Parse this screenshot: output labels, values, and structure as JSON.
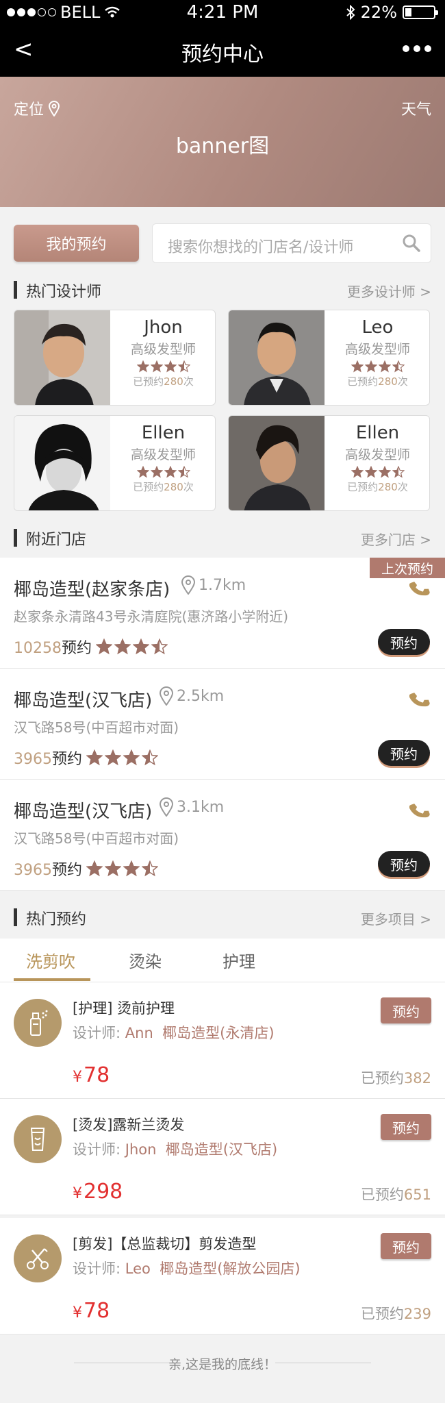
{
  "status_bar": {
    "carrier": "BELL",
    "time": "4:21 PM",
    "battery": "22%",
    "signal_dots_filled": 3,
    "signal_dots_total": 5
  },
  "navbar": {
    "back": "<",
    "title": "预约中心"
  },
  "banner": {
    "location_label": "定位",
    "weather_label": "天气",
    "text": "banner图"
  },
  "my_booking_button": "我的预约",
  "search": {
    "placeholder": "搜索你想找的门店名/设计师"
  },
  "designers_section": {
    "title": "热门设计师",
    "more": "更多设计师 >"
  },
  "designers": [
    {
      "name": "Jhon",
      "role": "高级发型师",
      "rating": 3.5,
      "count_prefix": "已预约",
      "count": "280",
      "count_suffix": "次"
    },
    {
      "name": "Leo",
      "role": "高级发型师",
      "rating": 3.5,
      "count_prefix": "已预约",
      "count": "280",
      "count_suffix": "次"
    },
    {
      "name": "Ellen",
      "role": "高级发型师",
      "rating": 3.5,
      "count_prefix": "已预约",
      "count": "280",
      "count_suffix": "次"
    },
    {
      "name": "Ellen",
      "role": "高级发型师",
      "rating": 3.5,
      "count_prefix": "已预约",
      "count": "280",
      "count_suffix": "次"
    }
  ],
  "stores_section": {
    "title": "附近门店",
    "more": "更多门店 >"
  },
  "stores": [
    {
      "name": "椰岛造型(赵家条店)",
      "distance": "1.7km",
      "address": "赵家条永清路43号永清庭院(惠济路小学附近)",
      "count": "10258",
      "count_label": "预约",
      "rating": 3.5,
      "book": "预约",
      "tag": "上次预约"
    },
    {
      "name": "椰岛造型(汉飞店)",
      "distance": "2.5km",
      "address": "汉飞路58号(中百超市对面)",
      "count": "3965",
      "count_label": "预约",
      "rating": 3.5,
      "book": "预约"
    },
    {
      "name": "椰岛造型(汉飞店)",
      "distance": "3.1km",
      "address": "汉飞路58号(中百超市对面)",
      "count": "3965",
      "count_label": "预约",
      "rating": 3.5,
      "book": "预约"
    }
  ],
  "hot_section": {
    "title": "热门预约",
    "more": "更多项目 >"
  },
  "tabs": [
    "洗剪吹",
    "烫染",
    "护理"
  ],
  "services": [
    {
      "icon": "spray-bottle-icon",
      "title": "[护理] 烫前护理",
      "designer_label": "设计师:",
      "designer": "Ann",
      "store": "椰岛造型(永清店)",
      "currency": "¥",
      "price": "78",
      "booked_label": "已预约",
      "booked": "382",
      "button": "预约"
    },
    {
      "icon": "hair-product-icon",
      "title": "[烫发]露新兰烫发",
      "designer_label": "设计师:",
      "designer": "Jhon",
      "store": "椰岛造型(汉飞店)",
      "currency": "¥",
      "price": "298",
      "booked_label": "已预约",
      "booked": "651",
      "button": "预约"
    },
    {
      "icon": "scissors-comb-icon",
      "title": "[剪发]【总监裁切】剪发造型",
      "designer_label": "设计师:",
      "designer": "Leo",
      "store": "椰岛造型(解放公园店)",
      "currency": "¥",
      "price": "78",
      "booked_label": "已预约",
      "booked": "239",
      "button": "预约"
    }
  ],
  "footer": "亲,这是我的底线！",
  "colors": {
    "accent_rose": "#b07a6e",
    "accent_gold": "#b8955a",
    "price_red": "#e23030",
    "star": "#9b6f64"
  }
}
